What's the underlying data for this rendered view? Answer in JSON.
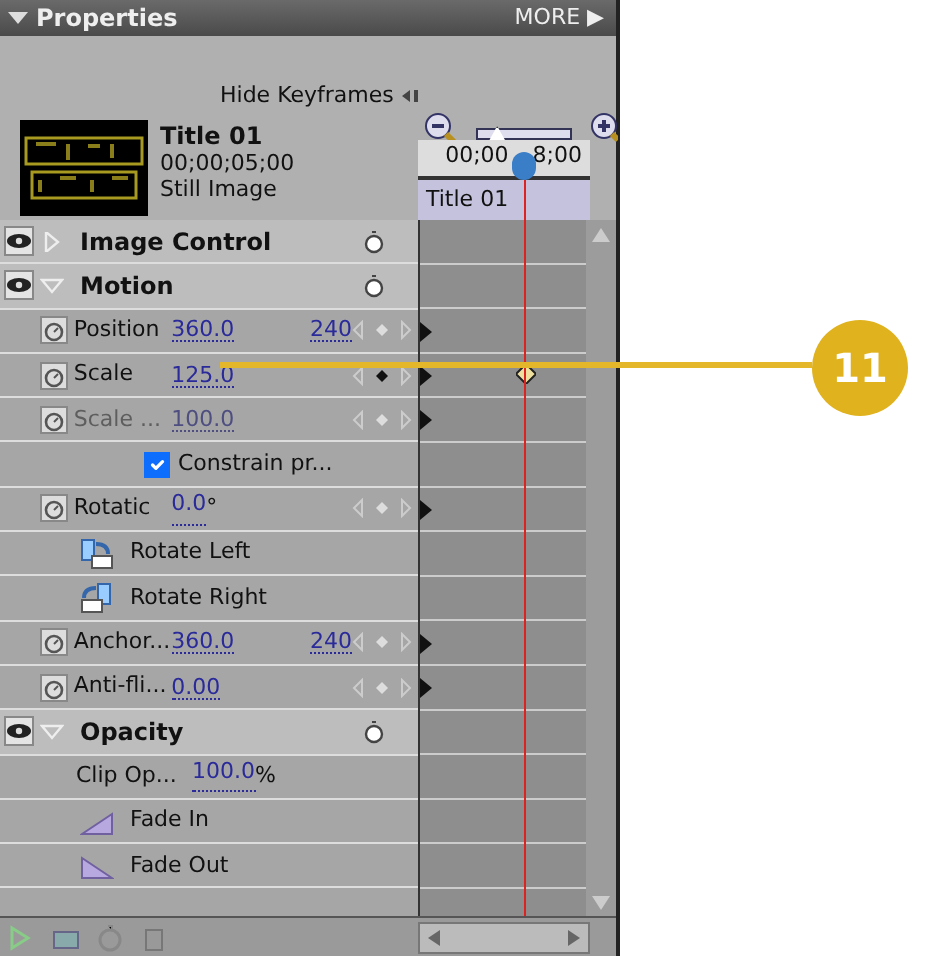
{
  "panel": {
    "title": "Properties",
    "more": "MORE ▶"
  },
  "hide_keyframes": "Hide Keyframes",
  "zoom": {
    "level": 0.2
  },
  "clip": {
    "name": "Title 01",
    "duration": "00;00;05;00",
    "type": "Still Image"
  },
  "timeline": {
    "time_left": "00;00",
    "time_right": "8;00",
    "clip_label": "Title 01"
  },
  "rows": [
    {
      "kind": "section",
      "label": "Image Control",
      "expanded": false,
      "visible": true
    },
    {
      "kind": "section",
      "label": "Motion",
      "expanded": true,
      "visible": true
    },
    {
      "kind": "property",
      "label": "Position",
      "values": [
        "360.0",
        "240"
      ],
      "disabled": false,
      "keyframe": false
    },
    {
      "kind": "property",
      "label": "Scale",
      "values": [
        "125.0"
      ],
      "disabled": false,
      "keyframe": true
    },
    {
      "kind": "property",
      "label": "Scale ...",
      "values": [
        "100.0"
      ],
      "disabled": true,
      "keyframe": false
    },
    {
      "kind": "checkbox",
      "label": "Constrain pr...",
      "checked": true
    },
    {
      "kind": "property",
      "label": "Rotatic",
      "values": [
        "0.0"
      ],
      "unit": "°",
      "disabled": false,
      "keyframe": false
    },
    {
      "kind": "action",
      "label": "Rotate Left"
    },
    {
      "kind": "action",
      "label": "Rotate Right"
    },
    {
      "kind": "property",
      "label": "Anchor...",
      "values": [
        "360.0",
        "240"
      ],
      "disabled": false,
      "keyframe": false
    },
    {
      "kind": "property",
      "label": "Anti-fli...",
      "values": [
        "0.00"
      ],
      "disabled": false,
      "keyframe": false
    },
    {
      "kind": "section",
      "label": "Opacity",
      "expanded": true,
      "visible": true
    },
    {
      "kind": "value",
      "label": "Clip Op...",
      "values": [
        "100.0"
      ],
      "unit": "%"
    },
    {
      "kind": "action",
      "label": "Fade In"
    },
    {
      "kind": "action",
      "label": "Fade Out"
    }
  ],
  "callout": {
    "number": "11"
  }
}
